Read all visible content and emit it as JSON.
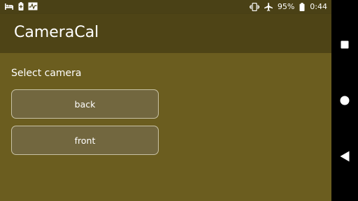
{
  "status_bar": {
    "battery_percent": "95%",
    "time": "0:44",
    "icons_left": [
      "bed-icon",
      "battery-saver-icon",
      "activity-icon"
    ],
    "icons_right": [
      "vibrate-icon",
      "airplane-icon",
      "battery-icon"
    ]
  },
  "app_bar": {
    "title": "CameraCal"
  },
  "main": {
    "section_label": "Select camera",
    "buttons": [
      {
        "label": "back"
      },
      {
        "label": "front"
      }
    ]
  },
  "nav_bar": {
    "icons": [
      "recents-icon",
      "home-icon",
      "back-icon"
    ]
  },
  "colors": {
    "app_bar": "#4e4416",
    "background": "#6b5d1f",
    "status_bar": "#4a4116",
    "nav_bar": "#000000"
  }
}
